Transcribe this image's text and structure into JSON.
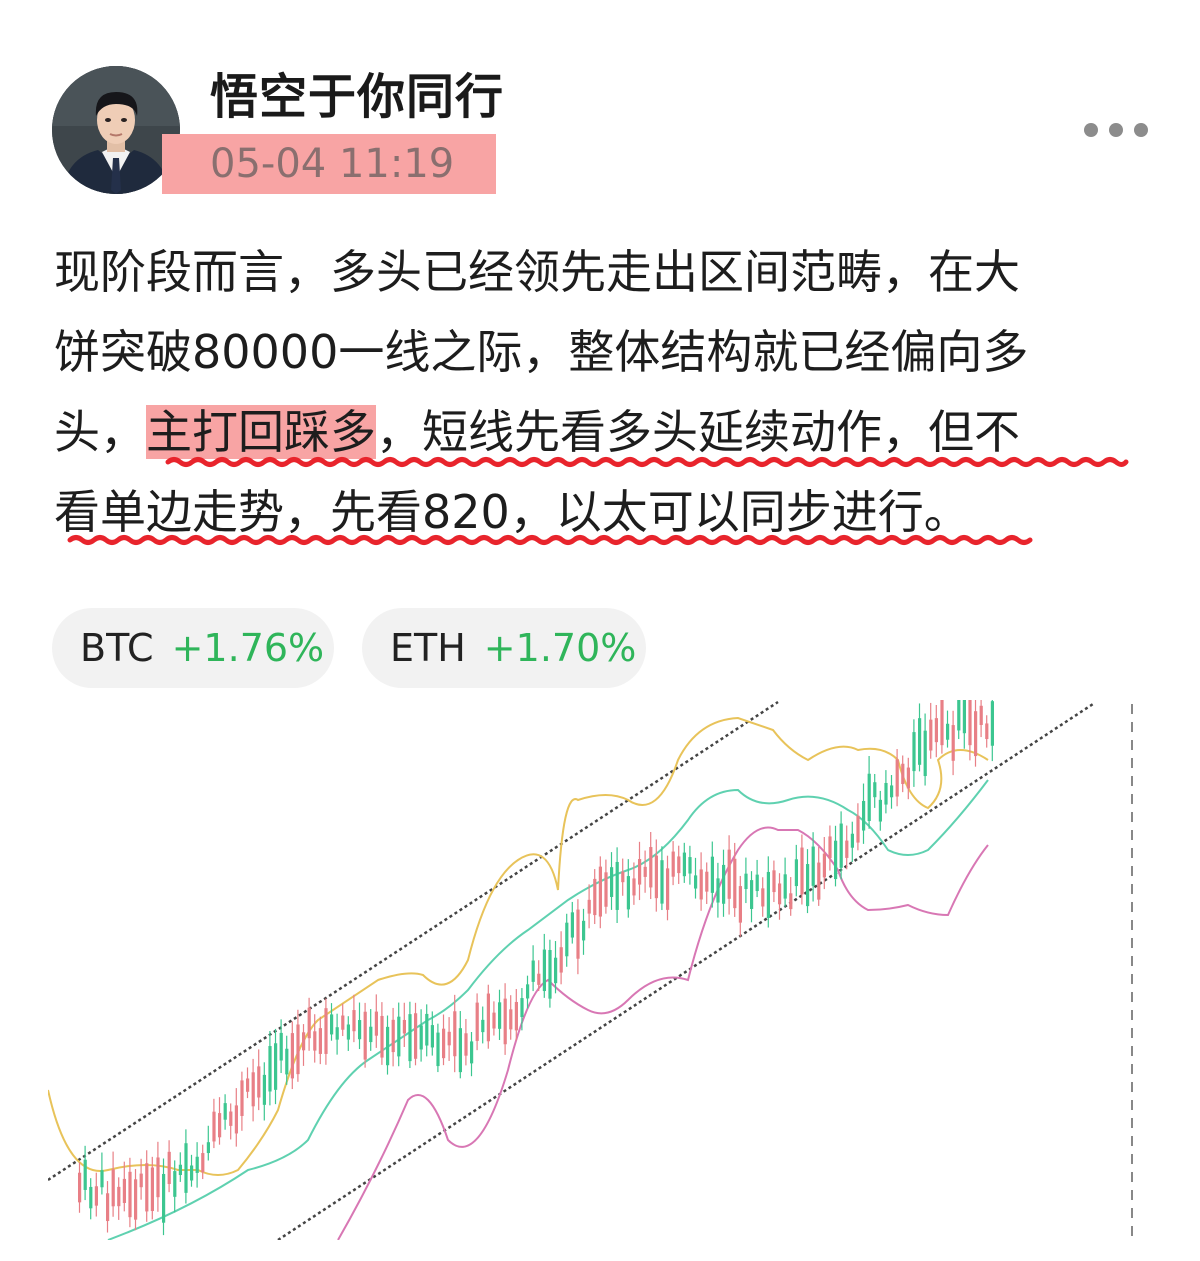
{
  "author": {
    "name": "悟空于你同行",
    "timestamp": "05-04 11:19",
    "avatar_icon": "avatar-portrait"
  },
  "more_icon": "more-horizontal-icon",
  "post": {
    "lines": [
      "现阶段而言，多头已经领先走出区间范畴，在大",
      "饼突破80000一线之际，整体结构就已经偏向多"
    ],
    "line3": {
      "pre": "头，",
      "highlight": "主打回踩多",
      "post": "，短线先看多头延续动作，但不"
    },
    "line4": "看单边走势，先看820，以太可以同步进行。"
  },
  "tickers": [
    {
      "symbol": "BTC",
      "change": "+1.76%"
    },
    {
      "symbol": "ETH",
      "change": "+1.70%"
    }
  ],
  "colors": {
    "highlight": "#f8a4a4",
    "positive": "#2fb55a",
    "wavy_underline": "#e8242c",
    "candle_up": "#3cc690",
    "candle_down": "#e87f86",
    "boll_upper": "#e8c35a",
    "boll_mid": "#5fd1b0",
    "boll_lower": "#d877b4"
  }
}
